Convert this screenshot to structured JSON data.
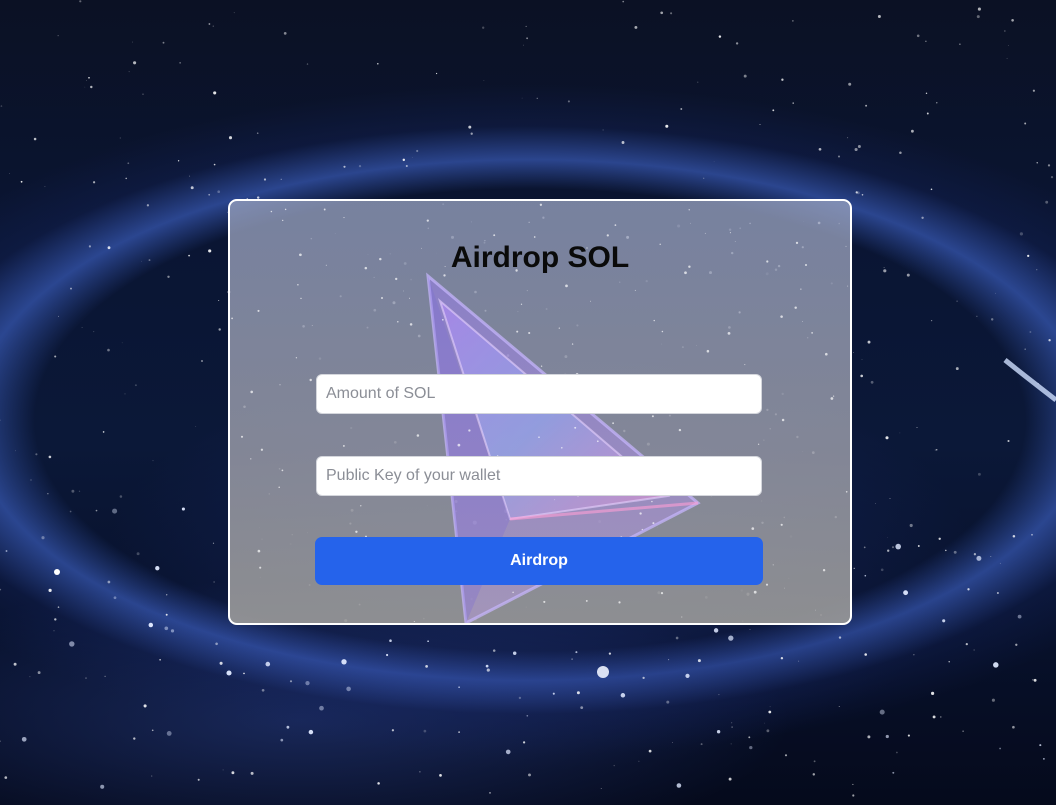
{
  "page": {
    "background": "space-nebula",
    "accent": "#2563eb"
  },
  "form": {
    "title": "Airdrop SOL",
    "amount": {
      "value": "",
      "placeholder": "Amount of SOL"
    },
    "public_key": {
      "value": "",
      "placeholder": "Public Key of your wallet"
    },
    "submit_label": "Airdrop"
  }
}
